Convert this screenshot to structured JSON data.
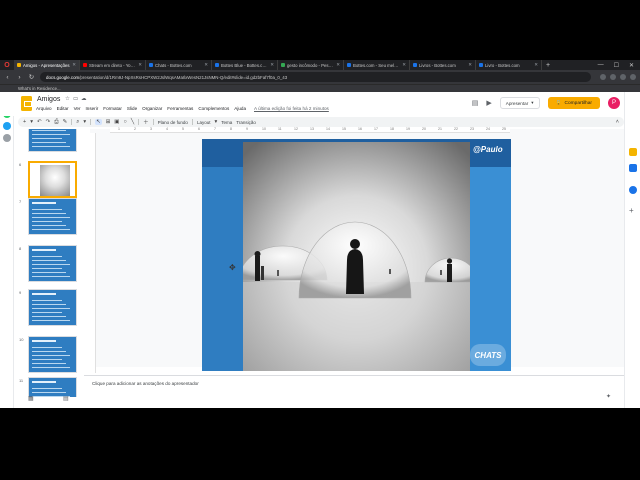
{
  "tabs": [
    {
      "label": "Amigos - Apresentações",
      "active": true,
      "color": "#f4b400"
    },
    {
      "label": "Stream em direto - YouTube",
      "active": false,
      "color": "#ff0000"
    },
    {
      "label": "Chats - Bottes.com",
      "active": false,
      "color": "#1a73e8"
    },
    {
      "label": "Bottes Blue - Bottes.com",
      "active": false,
      "color": "#1a73e8"
    },
    {
      "label": "gesto incômodo - Pesquisa",
      "active": false,
      "color": "#34a853"
    },
    {
      "label": "Bottes.com - Seu melhor",
      "active": false,
      "color": "#1a73e8"
    },
    {
      "label": "Livros - Bottes.com",
      "active": false,
      "color": "#1a73e8"
    },
    {
      "label": "Livro - Bottes.com",
      "active": false,
      "color": "#1a73e8"
    }
  ],
  "address": {
    "prefix": "docs.google.com",
    "path": "/presentation/d/1Rm9J-NpXsRsHCPXW2JslWqsAMaIlxWesN21JsNMN-Q/edit#slide=id.gd2bFaf7f0a_0_43"
  },
  "bookmarks": [
    "What's in Residence..."
  ],
  "doc": {
    "title": "Amigos",
    "menus": [
      "Arquivo",
      "Editar",
      "Ver",
      "Inserir",
      "Formatar",
      "Slide",
      "Organizar",
      "Ferramentas",
      "Complementos",
      "Ajuda"
    ],
    "last_edit": "A última edição foi feita há 2 minutos",
    "present_label": "Apresentar",
    "share_label": "Compartilhar",
    "avatar_letter": "P"
  },
  "toolbar": {
    "background_label": "Plano de fundo",
    "layout_label": "Layout",
    "theme_label": "Tema",
    "transition_label": "Transição"
  },
  "ruler": [
    "1",
    "2",
    "3",
    "4",
    "5",
    "6",
    "7",
    "8",
    "9",
    "10",
    "11",
    "12",
    "13",
    "14",
    "15",
    "16",
    "17",
    "18",
    "19",
    "20",
    "21",
    "22",
    "23",
    "24",
    "25"
  ],
  "filmstrip": [
    {
      "num": "",
      "kind": "text"
    },
    {
      "num": "6",
      "kind": "image"
    },
    {
      "num": "7",
      "kind": "text"
    },
    {
      "num": "8",
      "kind": "text"
    },
    {
      "num": "9",
      "kind": "text"
    },
    {
      "num": "10",
      "kind": "text"
    },
    {
      "num": "11",
      "kind": "text"
    }
  ],
  "slide": {
    "watermark": "@Paulo",
    "logo_text": "CHATS"
  },
  "notes": {
    "placeholder": "Clique para adicionar as anotações do apresentador"
  }
}
